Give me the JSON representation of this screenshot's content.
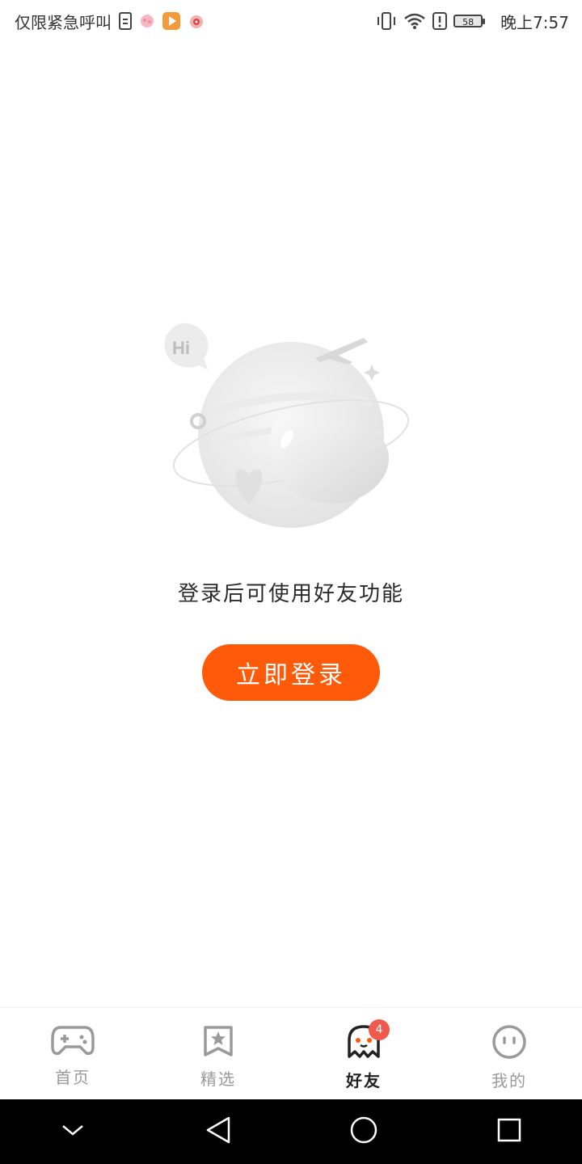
{
  "status_bar": {
    "carrier_text": "仅限紧急呼叫",
    "battery_level": "58",
    "time": "晚上7:57",
    "icons": [
      "document-icon",
      "brain-app-icon",
      "video-app-icon",
      "camera-app-icon",
      "vibrate-icon",
      "wifi-icon",
      "alert-icon",
      "battery-icon"
    ]
  },
  "empty_state": {
    "illustration_icon": "hearts-globe-illustration",
    "bubble_text": "Hi",
    "message": "登录后可使用好友功能",
    "login_button_label": "立即登录"
  },
  "tab_bar": {
    "tabs": [
      {
        "label": "首页",
        "icon": "gamepad-icon",
        "active": false
      },
      {
        "label": "精选",
        "icon": "star-bookmark-icon",
        "active": false
      },
      {
        "label": "好友",
        "icon": "ghost-icon",
        "active": true,
        "badge": "4"
      },
      {
        "label": "我的",
        "icon": "face-icon",
        "active": false
      }
    ]
  },
  "colors": {
    "accent": "#ff5a0a",
    "badge": "#f05a4e",
    "nav_bar": "#000000"
  }
}
